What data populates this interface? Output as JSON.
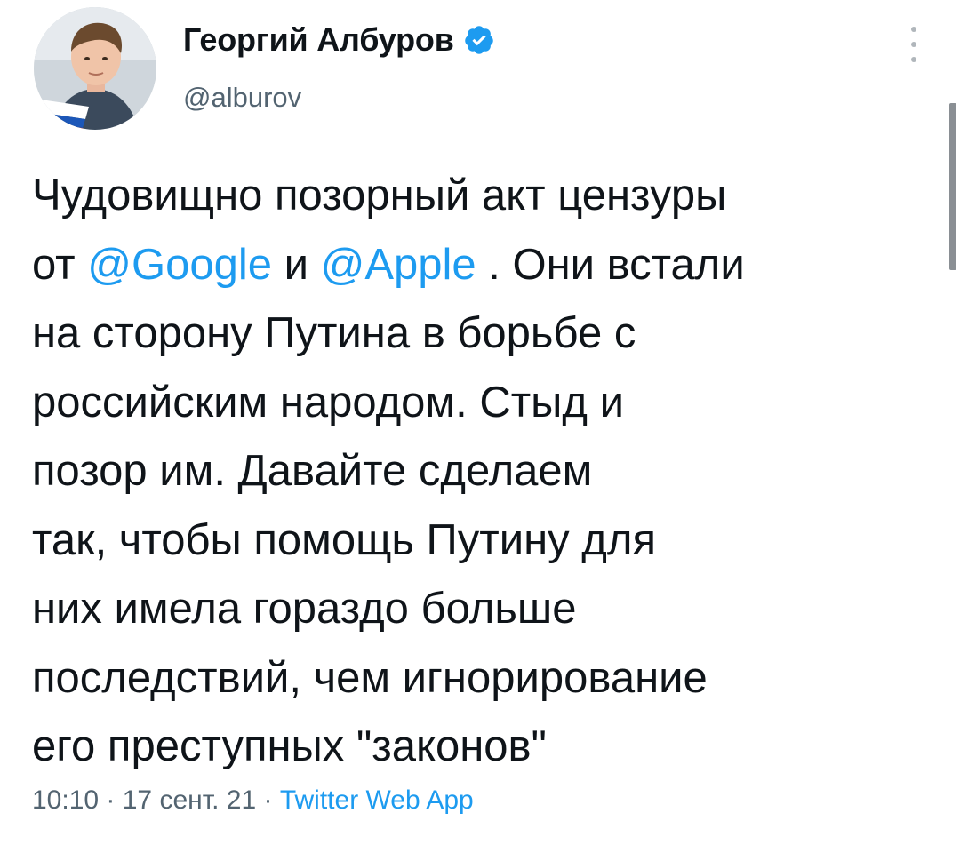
{
  "author": {
    "name": "Георгий Албуров",
    "handle": "@alburov",
    "verified": true
  },
  "tweet": {
    "line1": "Чудовищно позорный акт цензуры",
    "line2_prefix": "от ",
    "mention_google": "@Google",
    "line2_mid": " и ",
    "mention_apple": "@Apple",
    "line2_suffix": " . Они встали",
    "line3": "на сторону Путина в борьбе с",
    "line4": "российским народом. Стыд и",
    "line5": "позор им. Давайте сделаем",
    "line6": "так, чтобы помощь Путину для",
    "line7": "них имела гораздо больше",
    "line8": "последствий, чем игнорирование",
    "line9": "его преступных \"законов\""
  },
  "meta": {
    "time": "10:10",
    "separator": " · ",
    "date": "17 сент. 21",
    "source": "Twitter Web App"
  },
  "colors": {
    "accent": "#1d9bf0",
    "text": "#0f1419",
    "secondary": "#536471"
  },
  "icons": {
    "verified": "verified-badge-icon",
    "more": "more-vertical-icon"
  }
}
